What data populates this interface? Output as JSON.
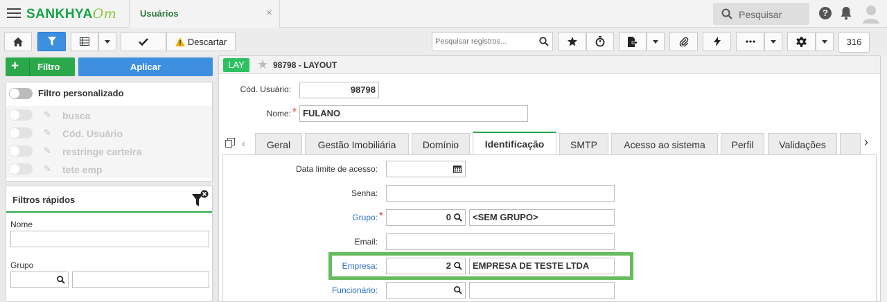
{
  "header": {
    "logo": "SANKHYA",
    "logo_suffix": "Om",
    "app_tab": "Usuários",
    "close_glyph": "×",
    "search_placeholder": "Pesquisar",
    "help_glyph": "?"
  },
  "toolbar": {
    "descartar_label": "Descartar",
    "search_placeholder": "Pesquisar registros...",
    "record_count": "316"
  },
  "left": {
    "filtro_label": "Filtro",
    "aplicar_label": "Aplicar",
    "filter_title": "Filtro personalizado",
    "filters": [
      "busca",
      "Cód. Usuário",
      "restringe carteira",
      "tete emp"
    ],
    "quick_title": "Filtros rápidos",
    "quick_nome_label": "Nome",
    "quick_grupo_label": "Grupo"
  },
  "record": {
    "badge": "LAY",
    "title": "98798 - LAYOUT",
    "cod_usuario_label": "Cód. Usuário:",
    "cod_usuario_value": "98798",
    "nome_label": "Nome:",
    "nome_value": "FULANO"
  },
  "tabs": [
    "Geral",
    "Gestão Imobiliária",
    "Domínio",
    "Identificação",
    "SMTP",
    "Acesso ao sistema",
    "Perfil",
    "Validações"
  ],
  "active_tab": "Identificação",
  "form": {
    "data_limite_label": "Data limite de acesso:",
    "senha_label": "Senha:",
    "grupo_label": "Grupo:",
    "grupo_code": "0",
    "grupo_desc": "<SEM GRUPO>",
    "email_label": "Email:",
    "empresa_label": "Empresa:",
    "empresa_code": "2",
    "empresa_desc": "EMPRESA DE TESTE LTDA",
    "funcionario_label": "Funcionário:"
  },
  "colors": {
    "brand_green": "#2aa84a",
    "primary_blue": "#3d8fe0",
    "highlight": "#66bb5c",
    "required": "#d9352b"
  }
}
